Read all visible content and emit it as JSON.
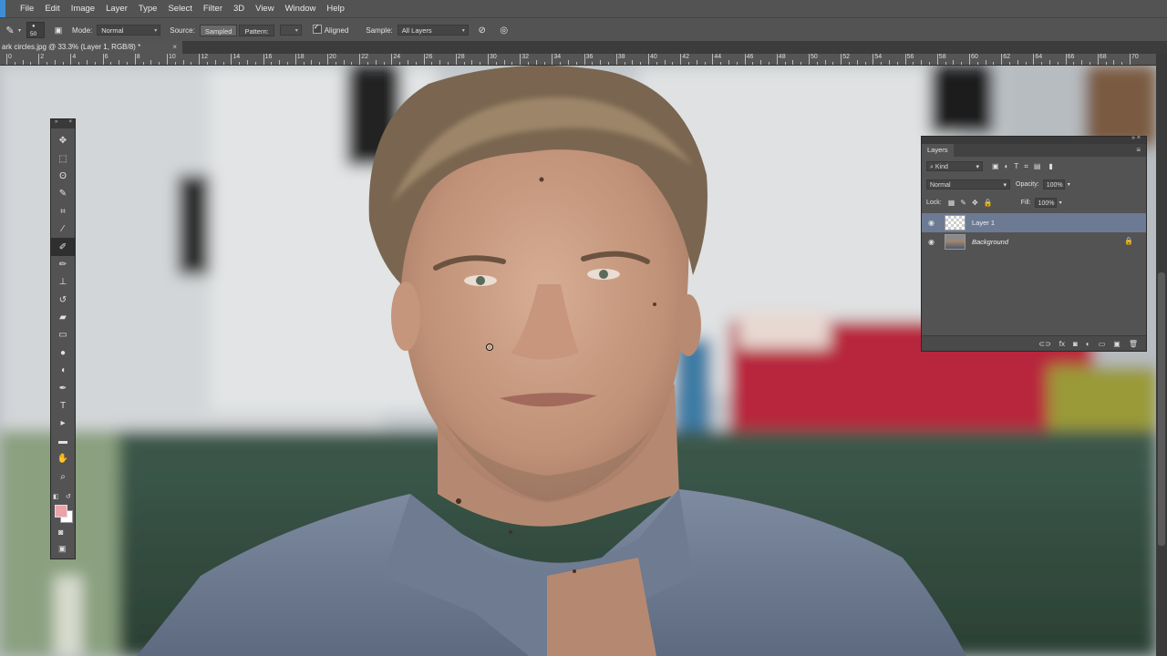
{
  "menubar": {
    "items": [
      "File",
      "Edit",
      "Image",
      "Layer",
      "Type",
      "Select",
      "Filter",
      "3D",
      "View",
      "Window",
      "Help"
    ]
  },
  "options": {
    "brush_size": "50",
    "mode_label": "Mode:",
    "mode_value": "Normal",
    "source_label": "Source:",
    "source_sampled": "Sampled",
    "source_pattern": "Pattern:",
    "aligned_label": "Aligned",
    "sample_label": "Sample:",
    "sample_value": "All Layers"
  },
  "document": {
    "tab_title": "ark circles.jpg @ 33.3% (Layer 1, RGB/8) *",
    "close_glyph": "×"
  },
  "ruler": {
    "labels": [
      "0",
      "2",
      "4",
      "6",
      "8",
      "10",
      "12",
      "14",
      "16",
      "18",
      "20",
      "22",
      "24",
      "26",
      "28",
      "30",
      "32",
      "34",
      "36",
      "38",
      "40",
      "42",
      "44",
      "46",
      "48",
      "50",
      "52",
      "54",
      "56",
      "58",
      "60",
      "62",
      "64",
      "66",
      "68",
      "70"
    ]
  },
  "toolbar": {
    "tools": [
      {
        "name": "move-tool-icon",
        "glyph": "✥"
      },
      {
        "name": "marquee-tool-icon",
        "glyph": "⬚"
      },
      {
        "name": "lasso-tool-icon",
        "glyph": "ʘ"
      },
      {
        "name": "quick-selection-tool-icon",
        "glyph": "✎"
      },
      {
        "name": "crop-tool-icon",
        "glyph": "⌗"
      },
      {
        "name": "eyedropper-tool-icon",
        "glyph": "⁄"
      },
      {
        "name": "healing-brush-tool-icon",
        "glyph": "✐"
      },
      {
        "name": "brush-tool-icon",
        "glyph": "✏"
      },
      {
        "name": "clone-stamp-tool-icon",
        "glyph": "⊥"
      },
      {
        "name": "history-brush-tool-icon",
        "glyph": "↺"
      },
      {
        "name": "eraser-tool-icon",
        "glyph": "▰"
      },
      {
        "name": "gradient-tool-icon",
        "glyph": "▭"
      },
      {
        "name": "blur-tool-icon",
        "glyph": "●"
      },
      {
        "name": "dodge-tool-icon",
        "glyph": "◖"
      },
      {
        "name": "pen-tool-icon",
        "glyph": "✒"
      },
      {
        "name": "type-tool-icon",
        "glyph": "T"
      },
      {
        "name": "path-selection-tool-icon",
        "glyph": "▸"
      },
      {
        "name": "rectangle-tool-icon",
        "glyph": "▬"
      },
      {
        "name": "hand-tool-icon",
        "glyph": "✋"
      },
      {
        "name": "zoom-tool-icon",
        "glyph": "⌕"
      }
    ],
    "active_index": 6,
    "foreground_color": "#eba2ab",
    "background_color": "#ffffff",
    "quick_mask_glyph": "◙",
    "screen_mode_glyph": "▣"
  },
  "layers_panel": {
    "tab_label": "Layers",
    "kind_label": "Kind",
    "blend_mode": "Normal",
    "opacity_label": "Opacity:",
    "opacity_value": "100%",
    "lock_label": "Lock:",
    "fill_label": "Fill:",
    "fill_value": "100%",
    "layers": [
      {
        "name": "Layer 1",
        "selected": true,
        "thumb": "transparent",
        "locked": false
      },
      {
        "name": "Background",
        "selected": false,
        "thumb": "photo",
        "locked": true
      }
    ],
    "footer_icons": [
      "link-icon",
      "fx-icon",
      "mask-icon",
      "adjustment-icon",
      "folder-icon",
      "new-layer-icon",
      "trash-icon"
    ],
    "footer_glyphs": [
      "⊂⊃",
      "fx",
      "◙",
      "◐",
      "▭",
      "▣",
      "🗑"
    ]
  },
  "colors": {
    "chrome": "#535353",
    "selected_layer": "#6c7b93",
    "ps_accent": "#3d8ed6"
  }
}
